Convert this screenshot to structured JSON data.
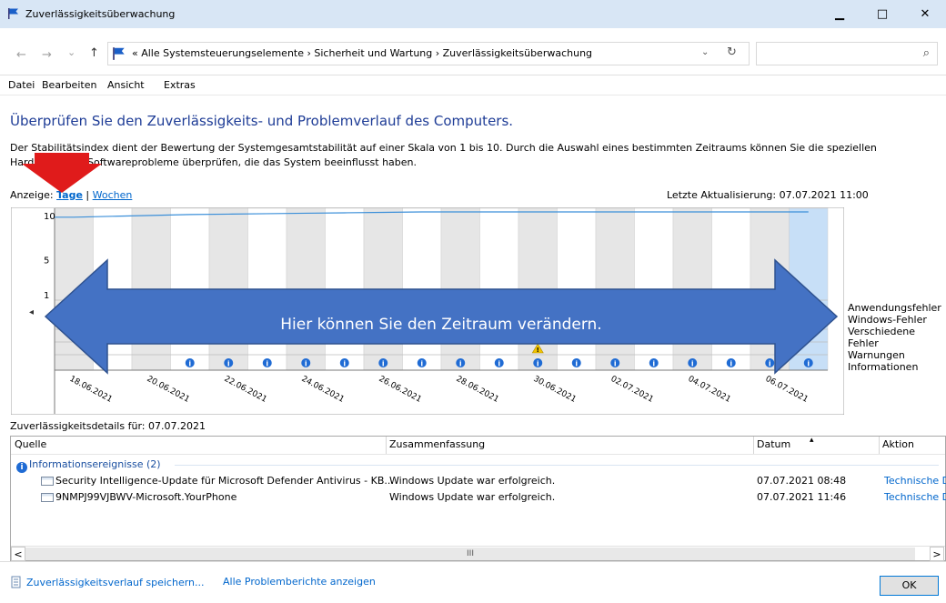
{
  "window": {
    "title": "Zuverlässigkeitsüberwachung",
    "min_glyph": "▁",
    "max_glyph": "□",
    "close_glyph": "✕"
  },
  "address": {
    "back_glyph": "←",
    "forward_glyph": "→",
    "recent_glyph": "⌄",
    "up_glyph": "↑",
    "path": "«  Alle Systemsteuerungselemente  ›  Sicherheit und Wartung  ›  Zuverlässigkeitsüberwachung",
    "dropdown_glyph": "⌄",
    "refresh_glyph": "↻",
    "search_placeholder": "",
    "search_glyph": "⌕"
  },
  "menu": [
    "Datei",
    "Bearbeiten",
    "Ansicht",
    "Extras"
  ],
  "page": {
    "heading": "Überprüfen Sie den Zuverlässigkeits- und Problemverlauf des Computers.",
    "intro": "Der Stabilitätsindex dient der Bewertung der Systemgesamtstabilität auf einer Skala von 1 bis 10. Durch die Auswahl eines bestimmten Zeitraums können Sie die speziellen Hardware- und Softwareprobleme überprüfen, die das System beeinflusst haben.",
    "view_label": "Anzeige:",
    "view_days": "Tage",
    "view_sep": "|",
    "view_weeks": "Wochen",
    "last_update": "Letzte Aktualisierung: 07.07.2021 11:00"
  },
  "chart_data": {
    "type": "line",
    "y_ticks": [
      "10",
      "5",
      "1"
    ],
    "ylim": [
      1,
      10
    ],
    "dates": [
      "18.06.2021",
      "20.06.2021",
      "22.06.2021",
      "24.06.2021",
      "26.06.2021",
      "28.06.2021",
      "30.06.2021",
      "02.07.2021",
      "04.07.2021",
      "06.07.2021"
    ],
    "stability_index": [
      9.4,
      9.5,
      9.6,
      9.7,
      9.75,
      9.8,
      9.85,
      9.9,
      9.95,
      10,
      10,
      10,
      10,
      10,
      10,
      10,
      10,
      10,
      10,
      10
    ],
    "info_markers": [
      false,
      false,
      false,
      true,
      true,
      true,
      true,
      true,
      true,
      true,
      true,
      true,
      true,
      true,
      true,
      true,
      true,
      true,
      true,
      true
    ],
    "warning_markers": [
      false,
      false,
      false,
      false,
      false,
      false,
      false,
      false,
      false,
      false,
      false,
      false,
      true,
      false,
      false,
      false,
      false,
      false,
      false,
      false
    ],
    "selected_index": 19,
    "left_arrow": "◂",
    "right_arrow": "▸",
    "legend": [
      "Anwendungsfehler",
      "Windows-Fehler",
      "Verschiedene Fehler",
      "Warnungen",
      "Informationen"
    ]
  },
  "annotation": {
    "text": "Hier können Sie den Zeitraum verändern.",
    "fill": "#4472c4",
    "arrow_color": "#e01b1b"
  },
  "details": {
    "label": "Zuverlässigkeitsdetails für: 07.07.2021",
    "columns": [
      "Quelle",
      "Zusammenfassung",
      "Datum",
      "Aktion"
    ],
    "sort_glyph": "▴",
    "group": "Informationsereignisse (2)",
    "rows": [
      {
        "source": "Security Intelligence-Update für Microsoft Defender Antivirus - KB...",
        "summary": "Windows Update war erfolgreich.",
        "date": "07.07.2021 08:48",
        "action": "Technische D"
      },
      {
        "source": "9NMPJ99VJBWV-Microsoft.YourPhone",
        "summary": "Windows Update war erfolgreich.",
        "date": "07.07.2021 11:46",
        "action": "Technische D"
      }
    ],
    "scroll_left": "<",
    "scroll_right": ">",
    "scroll_grip": "III"
  },
  "footer": {
    "save": "Zuverlässigkeitsverlauf speichern...",
    "all": "Alle Problemberichte anzeigen",
    "ok": "OK"
  }
}
